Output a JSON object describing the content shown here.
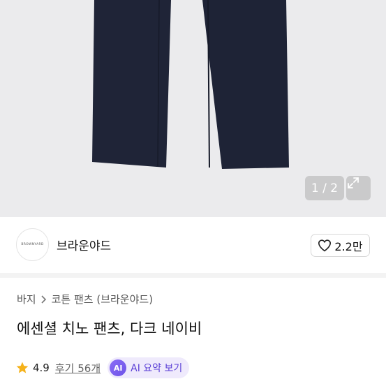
{
  "gallery": {
    "counter": "1 / 2"
  },
  "seller": {
    "logo_text": "BROWNYARD",
    "name": "브라운야드"
  },
  "like": {
    "count": "2.2만"
  },
  "breadcrumb": {
    "items": [
      "바지",
      "코튼 팬츠 (브라운야드)"
    ]
  },
  "product": {
    "title": "에센셜 치노 팬츠, 다크 네이비"
  },
  "rating": {
    "value": "4.9",
    "reviews_label": "후기 56개"
  },
  "ai_summary": {
    "badge": "AI",
    "label": "AI 요약 보기"
  },
  "colors": {
    "pants": "#1e2336",
    "background": "#ebebed",
    "star": "#f5b21a",
    "ai_accent": "#5b3fd6"
  }
}
